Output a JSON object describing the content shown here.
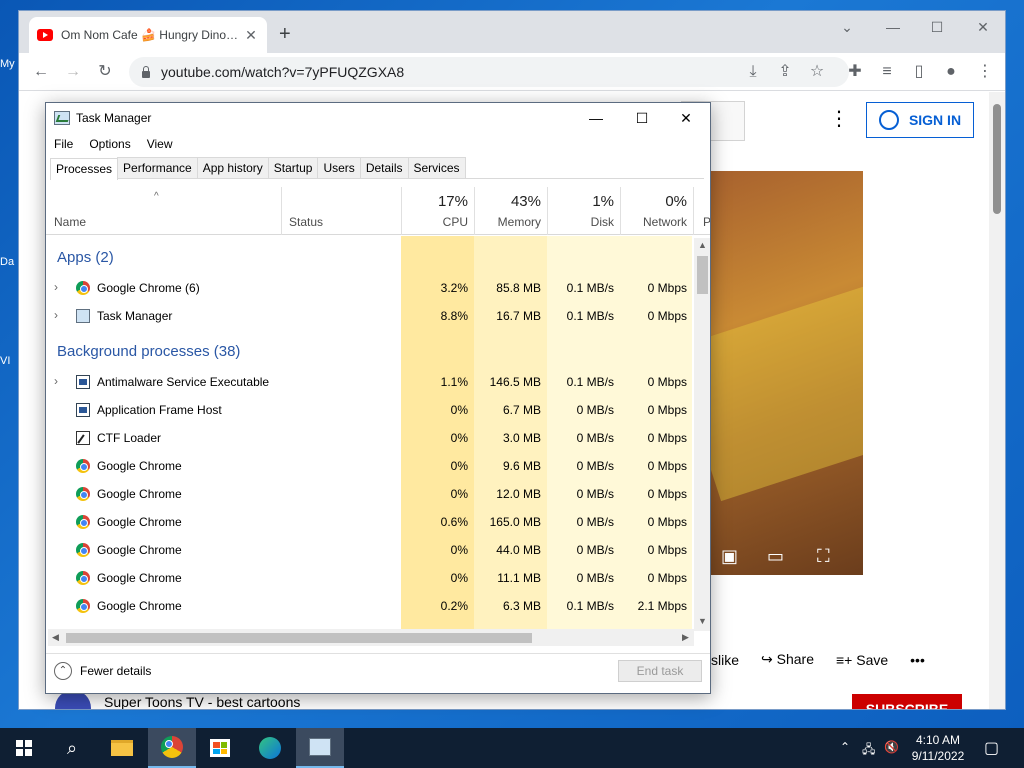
{
  "desktop": {
    "labels": [
      "My",
      "Da",
      "VI"
    ]
  },
  "browser": {
    "tab_title": "Om Nom Cafe 🍰 Hungry Dinosaurs",
    "url": "youtube.com/watch?v=7yPFUQZGXA8",
    "sign_in": "SIGN IN",
    "actions": [
      "slike",
      "Share",
      "Save"
    ],
    "channel_name": "Super Toons TV - best cartoons",
    "subscribe": "SUBSCRIBE"
  },
  "taskmgr": {
    "title": "Task Manager",
    "menu": [
      "File",
      "Options",
      "View"
    ],
    "tabs": [
      "Processes",
      "Performance",
      "App history",
      "Startup",
      "Users",
      "Details",
      "Services"
    ],
    "headers": {
      "name": "Name",
      "status": "Status",
      "cpu_pct": "17%",
      "cpu": "CPU",
      "mem_pct": "43%",
      "mem": "Memory",
      "disk_pct": "1%",
      "disk": "Disk",
      "net_pct": "0%",
      "net": "Network",
      "power": "P"
    },
    "groups": {
      "apps": "Apps (2)",
      "background": "Background processes (38)"
    },
    "apps": [
      {
        "name": "Google Chrome (6)",
        "cpu": "3.2%",
        "mem": "85.8 MB",
        "disk": "0.1 MB/s",
        "net": "0 Mbps",
        "icon": "chrome-icon",
        "expandable": true
      },
      {
        "name": "Task Manager",
        "cpu": "8.8%",
        "mem": "16.7 MB",
        "disk": "0.1 MB/s",
        "net": "0 Mbps",
        "icon": "task-manager-icon",
        "expandable": true
      }
    ],
    "background": [
      {
        "name": "Antimalware Service Executable",
        "cpu": "1.1%",
        "mem": "146.5 MB",
        "disk": "0.1 MB/s",
        "net": "0 Mbps",
        "icon": "service-icon",
        "expandable": true
      },
      {
        "name": "Application Frame Host",
        "cpu": "0%",
        "mem": "6.7 MB",
        "disk": "0 MB/s",
        "net": "0 Mbps",
        "icon": "service-icon",
        "expandable": false
      },
      {
        "name": "CTF Loader",
        "cpu": "0%",
        "mem": "3.0 MB",
        "disk": "0 MB/s",
        "net": "0 Mbps",
        "icon": "ctf-icon",
        "expandable": false
      },
      {
        "name": "Google Chrome",
        "cpu": "0%",
        "mem": "9.6 MB",
        "disk": "0 MB/s",
        "net": "0 Mbps",
        "icon": "chrome-icon",
        "expandable": false
      },
      {
        "name": "Google Chrome",
        "cpu": "0%",
        "mem": "12.0 MB",
        "disk": "0 MB/s",
        "net": "0 Mbps",
        "icon": "chrome-icon",
        "expandable": false
      },
      {
        "name": "Google Chrome",
        "cpu": "0.6%",
        "mem": "165.0 MB",
        "disk": "0 MB/s",
        "net": "0 Mbps",
        "icon": "chrome-icon",
        "expandable": false
      },
      {
        "name": "Google Chrome",
        "cpu": "0%",
        "mem": "44.0 MB",
        "disk": "0 MB/s",
        "net": "0 Mbps",
        "icon": "chrome-icon",
        "expandable": false
      },
      {
        "name": "Google Chrome",
        "cpu": "0%",
        "mem": "11.1 MB",
        "disk": "0 MB/s",
        "net": "0 Mbps",
        "icon": "chrome-icon",
        "expandable": false
      },
      {
        "name": "Google Chrome",
        "cpu": "0.2%",
        "mem": "6.3 MB",
        "disk": "0.1 MB/s",
        "net": "2.1 Mbps",
        "icon": "chrome-icon",
        "expandable": false
      }
    ],
    "footer": {
      "fewer_details": "Fewer details",
      "end_task": "End task"
    }
  },
  "taskbar": {
    "time": "4:10 AM",
    "date": "9/11/2022"
  },
  "colors": {
    "heat_light": "#fff9d8",
    "heat_mid": "#fff2bf",
    "heat_strong": "#ffe9a0",
    "group_title": "#2a57a5"
  }
}
